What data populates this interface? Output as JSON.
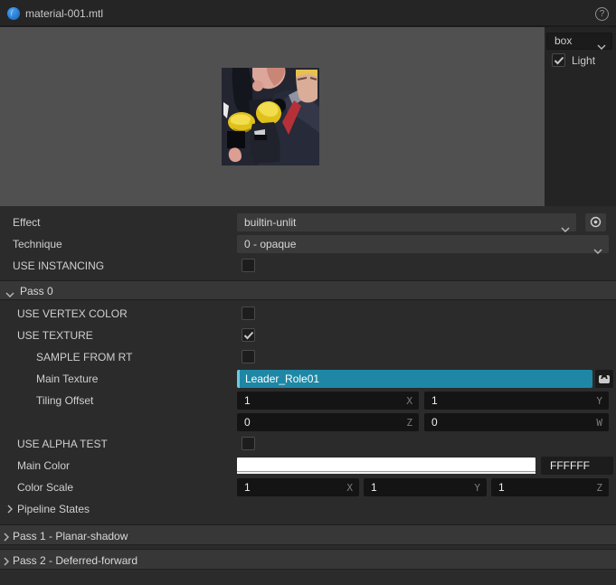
{
  "titlebar": {
    "title": "material-001.mtl",
    "help": "?"
  },
  "preview": {
    "shape_select": {
      "value": "box"
    },
    "light": {
      "label": "Light",
      "checked": true
    }
  },
  "rows": {
    "effect": {
      "label": "Effect",
      "value": "builtin-unlit"
    },
    "technique": {
      "label": "Technique",
      "value": "0 - opaque"
    },
    "use_instancing": {
      "label": "USE INSTANCING",
      "checked": false
    },
    "pass0": {
      "label": "Pass 0",
      "expanded": true
    },
    "use_vertex_color": {
      "label": "USE VERTEX COLOR",
      "checked": false
    },
    "use_texture": {
      "label": "USE TEXTURE",
      "checked": true
    },
    "sample_from_rt": {
      "label": "SAMPLE FROM RT",
      "checked": false
    },
    "main_texture": {
      "label": "Main Texture",
      "value": "Leader_Role01"
    },
    "tiling_offset": {
      "label": "Tiling Offset",
      "x": {
        "value": "1",
        "axis": "X"
      },
      "y": {
        "value": "1",
        "axis": "Y"
      },
      "z": {
        "value": "0",
        "axis": "Z"
      },
      "w": {
        "value": "0",
        "axis": "W"
      }
    },
    "use_alpha_test": {
      "label": "USE ALPHA TEST",
      "checked": false
    },
    "main_color": {
      "label": "Main Color",
      "hex": "FFFFFF",
      "swatch_css": "background:#FFFFFF"
    },
    "color_scale": {
      "label": "Color Scale",
      "x": {
        "value": "1",
        "axis": "X"
      },
      "y": {
        "value": "1",
        "axis": "Y"
      },
      "z": {
        "value": "1",
        "axis": "Z"
      }
    },
    "pipeline_states": {
      "label": "Pipeline States",
      "expanded": false
    },
    "pass1": {
      "label": "Pass 1 - Planar-shadow",
      "expanded": false
    },
    "pass2": {
      "label": "Pass 2 - Deferred-forward",
      "expanded": false
    }
  },
  "colors": {
    "selected_asset_teal": "#1E87A5",
    "selected_asset_edge": "#6CC9E2",
    "main_color_value": "#FFFFFF",
    "panel_bg": "#2B2B2B",
    "viewport_bg": "#505050",
    "field_bg": "#141414",
    "header_bg": "#373737",
    "title_icon_blue": "#2A7FD4"
  }
}
